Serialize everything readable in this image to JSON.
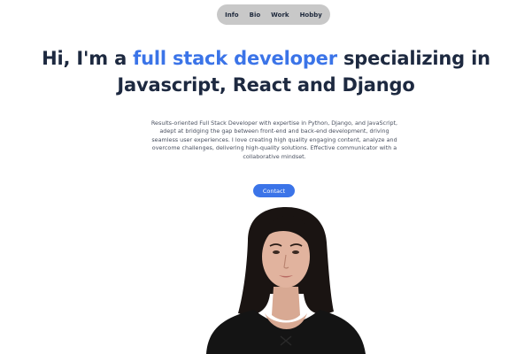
{
  "nav": {
    "items": [
      "Info",
      "Bio",
      "Work",
      "Hobby"
    ]
  },
  "hero": {
    "heading_prefix": "Hi, I'm a ",
    "heading_accent": "full stack developer",
    "heading_suffix": " specializing in Javascript, React and Django",
    "bio": "Results-oriented Full Stack Developer with expertise in Python, Django, and JavaScript, adept at bridging the gap between front-end and back-end development, driving seamless user experiences. I love creating high quality engaging content, analyze and overcome challenges, delivering high-quality solutions. Effective communicator with a collaborative mindset.",
    "contact_label": "Contact"
  },
  "colors": {
    "accent": "#3b74e8",
    "heading": "#1d2940",
    "nav_bg": "#c8c8c8"
  }
}
